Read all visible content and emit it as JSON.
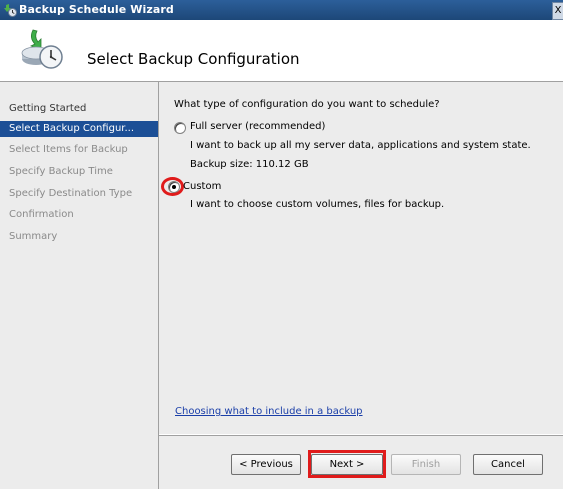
{
  "window": {
    "title": "Backup Schedule Wizard",
    "close_glyph": "X"
  },
  "header": {
    "title": "Select Backup Configuration",
    "icon": "backup-schedule-icon"
  },
  "nav": {
    "items": [
      {
        "label": "Getting Started",
        "state": "done"
      },
      {
        "label": "Select Backup Configur...",
        "state": "active"
      },
      {
        "label": "Select Items for Backup",
        "state": "pending"
      },
      {
        "label": "Specify Backup Time",
        "state": "pending"
      },
      {
        "label": "Specify Destination Type",
        "state": "pending"
      },
      {
        "label": "Confirmation",
        "state": "pending"
      },
      {
        "label": "Summary",
        "state": "pending"
      }
    ]
  },
  "content": {
    "question": "What type of configuration do you want to schedule?",
    "options": [
      {
        "label": "Full server (recommended)",
        "description": "I want to back up all my server data, applications and system state.",
        "extra": "Backup size: 110.12 GB",
        "selected": false
      },
      {
        "label": "Custom",
        "description": "I want to choose custom volumes, files for backup.",
        "selected": true
      }
    ],
    "help_link": "Choosing what to include in a backup"
  },
  "buttons": {
    "previous": "< Previous",
    "next": "Next >",
    "finish": "Finish",
    "cancel": "Cancel"
  },
  "colors": {
    "titlebar": "#1d4778",
    "nav_active": "#1c4f96",
    "highlight": "#e01b1b",
    "link": "#1a3ea8"
  }
}
